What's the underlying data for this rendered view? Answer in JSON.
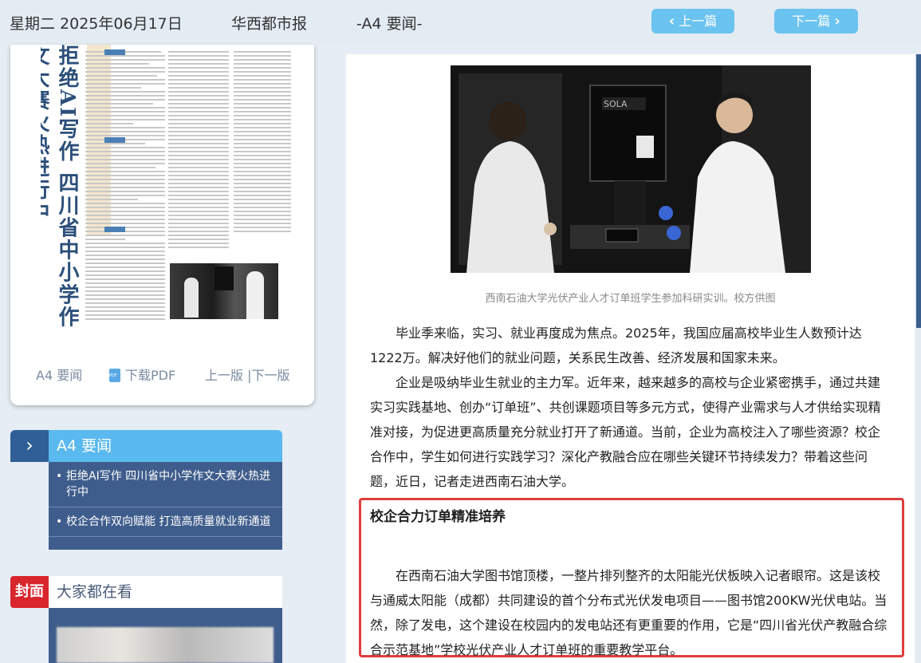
{
  "header": {
    "date": "星期二 2025年06月17日",
    "paper": "华西都市报",
    "edition": "-A4 要闻-",
    "prev_label": "上一篇",
    "next_label": "下一篇",
    "prev_icon": "chevron-left-icon",
    "next_icon": "chevron-right-icon"
  },
  "page_card": {
    "thumb_title": "拒绝AI写作 四川省中小学作文大赛火热进行中",
    "page_label": "A4 要闻",
    "pdf_label": "下载PDF",
    "version_nav": "上一版 |下一版"
  },
  "section": {
    "title": "A4  要闻",
    "items": [
      "拒绝AI写作 四川省中小学作文大赛火热进行中",
      "校企合作双向赋能 打造高质量就业新通道"
    ]
  },
  "cover": {
    "badge": "封面",
    "title": "大家都在看"
  },
  "article": {
    "photo_caption": "西南石油大学光伏产业人才订单班学生参加科研实训。校方供图",
    "paragraphs": [
      "毕业季来临，实习、就业再度成为焦点。2025年，我国应届高校毕业生人数预计达1222万。解决好他们的就业问题，关系民生改善、经济发展和国家未来。",
      "企业是吸纳毕业生就业的主力军。近年来，越来越多的高校与企业紧密携手，通过共建实习实践基地、创办“订单班”、共创课题项目等多元方式，使得产业需求与人才供给实现精准对接，为促进更高质量充分就业打开了新通道。当前，企业为高校注入了哪些资源？校企合作中，学生如何进行实践学习？深化产教融合应在哪些关键环节持续发力？带着这些问题，近日，记者走进西南石油大学。"
    ],
    "subheading": "校企合力订单精准培养",
    "paragraph3": "在西南石油大学图书馆顶楼，一整片排列整齐的太阳能光伏板映入记者眼帘。这是该校与通威太阳能（成都）共同建设的首个分布式光伏发电项目——图书馆200KW光伏电站。当然，除了发电，这个建设在校园内的发电站还有更重要的作用，它是“四川省光伏产教融合综合示范基地”学校光伏产业人才订单班的重要教学平台。",
    "equipment_text": "SOLA",
    "highlight_color": "#e03c3c"
  },
  "colors": {
    "nav_button": "#6bc3ef",
    "section_dark": "#2f5f96",
    "section_light": "#5ab9ee",
    "cover_red": "#d8262c"
  }
}
